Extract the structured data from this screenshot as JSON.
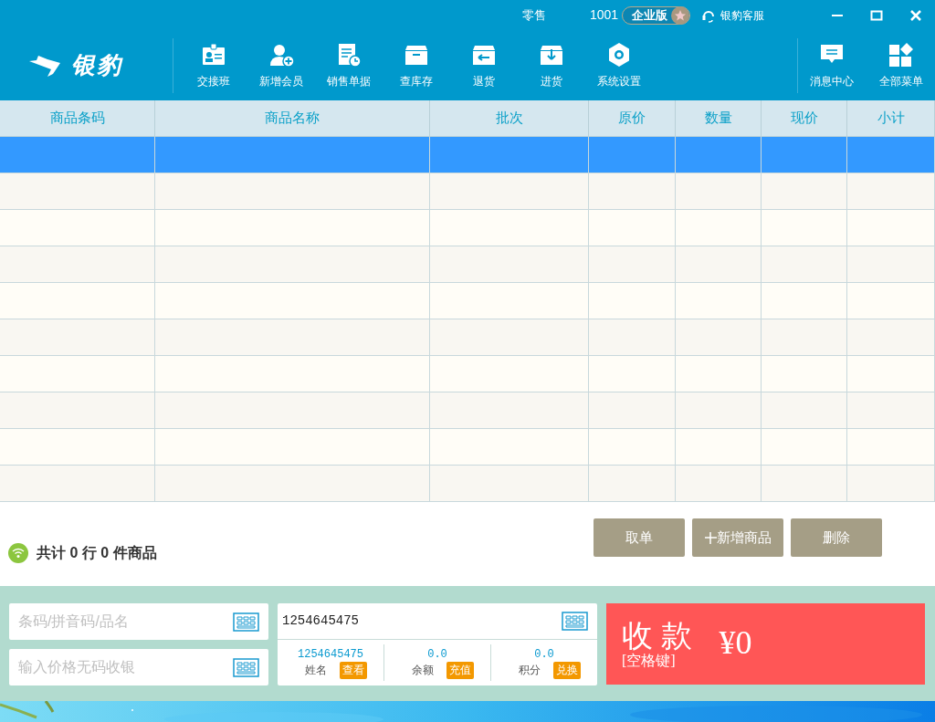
{
  "window": {
    "title": "零售",
    "user_id": "1001",
    "edition": "企业版",
    "support": "银豹客服"
  },
  "logo": {
    "text": "银豹"
  },
  "toolbar": [
    {
      "label": "交接班",
      "kind": "badge"
    },
    {
      "label": "新增会员",
      "kind": "member"
    },
    {
      "label": "销售单据",
      "kind": "doc"
    },
    {
      "label": "查库存",
      "kind": "box"
    },
    {
      "label": "退货",
      "kind": "return"
    },
    {
      "label": "进货",
      "kind": "inbox"
    },
    {
      "label": "系统设置",
      "kind": "gear"
    }
  ],
  "toolbar_right": [
    {
      "label": "消息中心",
      "kind": "message"
    },
    {
      "label": "全部菜单",
      "kind": "grid"
    }
  ],
  "table": {
    "columns": [
      "商品条码",
      "商品名称",
      "批次",
      "原价",
      "数量",
      "现价",
      "小计"
    ],
    "rows": [
      {
        "selected": true
      },
      {
        "selected": false
      },
      {
        "selected": false
      },
      {
        "selected": false
      },
      {
        "selected": false
      },
      {
        "selected": false
      },
      {
        "selected": false
      },
      {
        "selected": false
      },
      {
        "selected": false
      },
      {
        "selected": false
      }
    ]
  },
  "summary": "共计 0 行 0 件商品",
  "actions": [
    "取单",
    "新增商品",
    "删除"
  ],
  "search": [
    {
      "placeholder": "条码/拼音码/品名"
    },
    {
      "placeholder": "输入价格无码收银"
    }
  ],
  "member": {
    "value": "1254645475",
    "stats": [
      {
        "value": "1254645475",
        "label": "姓名",
        "action": "查看"
      },
      {
        "value": "0.0",
        "label": "余额",
        "action": "充值"
      },
      {
        "value": "0.0",
        "label": "积分",
        "action": "兑换"
      }
    ]
  },
  "checkout": {
    "label": "收 款",
    "hint": "[空格键]",
    "amount": "¥0"
  }
}
